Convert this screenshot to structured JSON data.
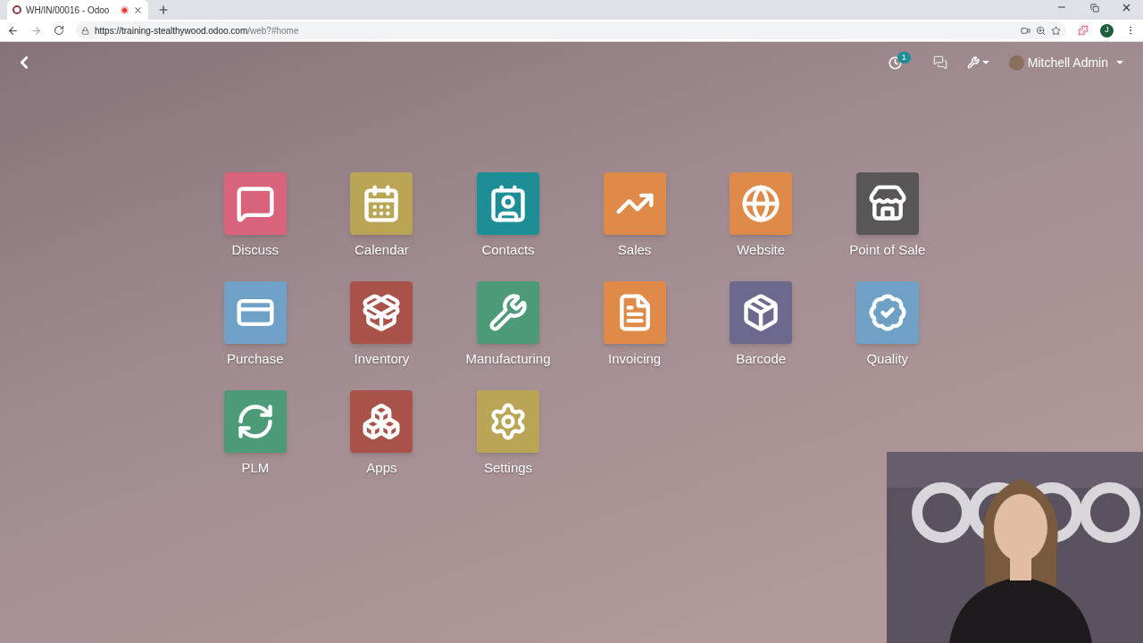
{
  "browser": {
    "tab_title": "WH/IN/00016 - Odoo",
    "url_host": "https://training-stealthywood.odoo.com",
    "url_path": "/web?#home",
    "profile_initial": "J"
  },
  "navbar": {
    "activity_count": "1",
    "user": "Mitchell Admin"
  },
  "apps": [
    {
      "label": "Discuss",
      "kind": "discuss",
      "color": "#d9637a"
    },
    {
      "label": "Calendar",
      "kind": "calendar",
      "color": "#b9a555"
    },
    {
      "label": "Contacts",
      "kind": "contacts",
      "color": "#1d8d96"
    },
    {
      "label": "Sales",
      "kind": "sales",
      "color": "#e08a4a"
    },
    {
      "label": "Website",
      "kind": "website",
      "color": "#e08a4a"
    },
    {
      "label": "Point of Sale",
      "kind": "pos",
      "color": "#5a5556"
    },
    {
      "label": "Purchase",
      "kind": "purchase",
      "color": "#6fa1c7"
    },
    {
      "label": "Inventory",
      "kind": "inventory",
      "color": "#a9524a"
    },
    {
      "label": "Manufacturing",
      "kind": "manufacturing",
      "color": "#4d9a78"
    },
    {
      "label": "Invoicing",
      "kind": "invoicing",
      "color": "#e08a4a"
    },
    {
      "label": "Barcode",
      "kind": "barcode",
      "color": "#6b6a8e"
    },
    {
      "label": "Quality",
      "kind": "quality",
      "color": "#6fa1c7"
    },
    {
      "label": "PLM",
      "kind": "plm",
      "color": "#4d9a78"
    },
    {
      "label": "Apps",
      "kind": "apps",
      "color": "#a9524a"
    },
    {
      "label": "Settings",
      "kind": "settings",
      "color": "#b9a555"
    }
  ]
}
